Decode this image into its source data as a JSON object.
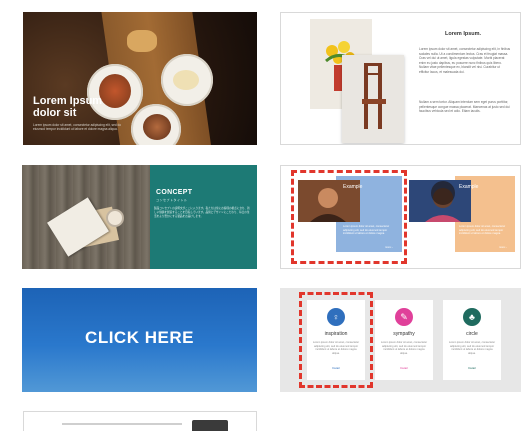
{
  "cards": {
    "hero": {
      "title": "Lorem Ipsum dolor sit",
      "body": "Lorem ipsum dolor sit amet, consectetur adipiscing elit, sed do eiusmod tempor incididunt ut labore et dolore magna aliqua."
    },
    "article": {
      "title": "Lorem Ipsum.",
      "paragraph1": "Lorem ipsum dolor sit amet, consectetur adipiscing elit, in finibus sodales nulla. Ut a condimentum lectus. Cras et feugiat massa. Cras vel dui ut amet, ligula egestas vulputate. Morbi placerat enim eu justo dapibus, eu posuere nunc finibus quis libero. Nullam vitae pellentesque ex, blandit vel nisi. Curabitur ut efficitur lacus, et malesuada dui.",
      "paragraph2": "Nullam a sem tortor. Aliquam interdum sem eget purus porttitor, pellentesque congue massa placerat. Maecenas at justo sed dui faucibus vehicula sed et odio. Etiam iaculis."
    },
    "concept": {
      "title": "CONCEPT",
      "subtitle": "コンセプトタイトル",
      "body": "製品コンセプトの説明文がここに入ります。私たちは常にお客様の視点に立ち、新しい価値を創造することを目指しています。品質とデザインにこだわり、毎日の生活をより豊かにする製品をお届けします。"
    },
    "profiles": {
      "items": [
        {
          "label": "Example",
          "text": "Lorem ipsum dolor sit amet, consectetur adipiscing elit, sed do eiusmod tempor incididunt ut labore et dolore magna.",
          "more": "more ›",
          "color": "#8fb3df"
        },
        {
          "label": "Example",
          "text": "Lorem ipsum dolor sit amet, consectetur adipiscing elit, sed do eiusmod tempor incididunt ut labore et dolore magna.",
          "more": "more ›",
          "color": "#f4c08e"
        }
      ]
    },
    "cta": {
      "label": "CLICK HERE",
      "color": "#2a78cc"
    },
    "icon_cards": {
      "items": [
        {
          "label": "inspiration",
          "icon": "lightbulb-icon",
          "glyph": "♀",
          "color": "#2f6fbd",
          "text": "Lorem ipsum dolor sit amet, consectetur adipiscing elit, sed do eiusmod tempor incididunt ut labore et dolore magna aliqua.",
          "detail": "Detail"
        },
        {
          "label": "sympathy",
          "icon": "tag-icon",
          "glyph": "✎",
          "color": "#e0409a",
          "text": "Lorem ipsum dolor sit amet, consectetur adipiscing elit, sed do eiusmod tempor incididunt ut labore et dolore magna aliqua.",
          "detail": "Detail"
        },
        {
          "label": "circle",
          "icon": "group-icon",
          "glyph": "♣",
          "color": "#1f6b5f",
          "text": "Lorem ipsum dolor sit amet, consectetur adipiscing elit, sed do eiusmod tempor incididunt ut labore et dolore magna aliqua.",
          "detail": "Detail"
        }
      ]
    }
  },
  "colors": {
    "teal": "#1d7a75",
    "dashed_highlight": "#e1362c"
  }
}
